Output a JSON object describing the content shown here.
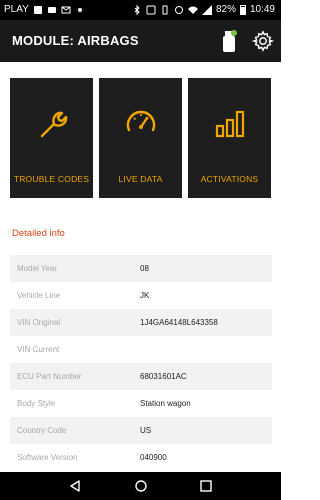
{
  "status_bar": {
    "carrier": "PLAY",
    "battery": "82%",
    "time": "10:49"
  },
  "header": {
    "title": "MODULE: AIRBAGS"
  },
  "tiles": [
    {
      "label": "TROUBLE CODES",
      "icon": "wrench-icon"
    },
    {
      "label": "LIVE DATA",
      "icon": "speedometer-icon"
    },
    {
      "label": "ACTIVATIONS",
      "icon": "bars-icon"
    }
  ],
  "details": {
    "title": "Detailed info",
    "rows": [
      {
        "label": "Model Year",
        "value": "08"
      },
      {
        "label": "Vehicle Line",
        "value": "JK"
      },
      {
        "label": "VIN Original",
        "value": "1J4GA64148L643358"
      },
      {
        "label": "VIN Current",
        "value": ""
      },
      {
        "label": "ECU Part Number",
        "value": "68031601AC"
      },
      {
        "label": "Body Style",
        "value": "Station wagon"
      },
      {
        "label": "Country Code",
        "value": "US"
      },
      {
        "label": "Software Version",
        "value": "040900"
      }
    ]
  },
  "colors": {
    "accent": "#f0a500",
    "section_title": "#d84315",
    "tile_bg": "#1e1e1e",
    "appbar_bg": "#1a1a1a"
  }
}
